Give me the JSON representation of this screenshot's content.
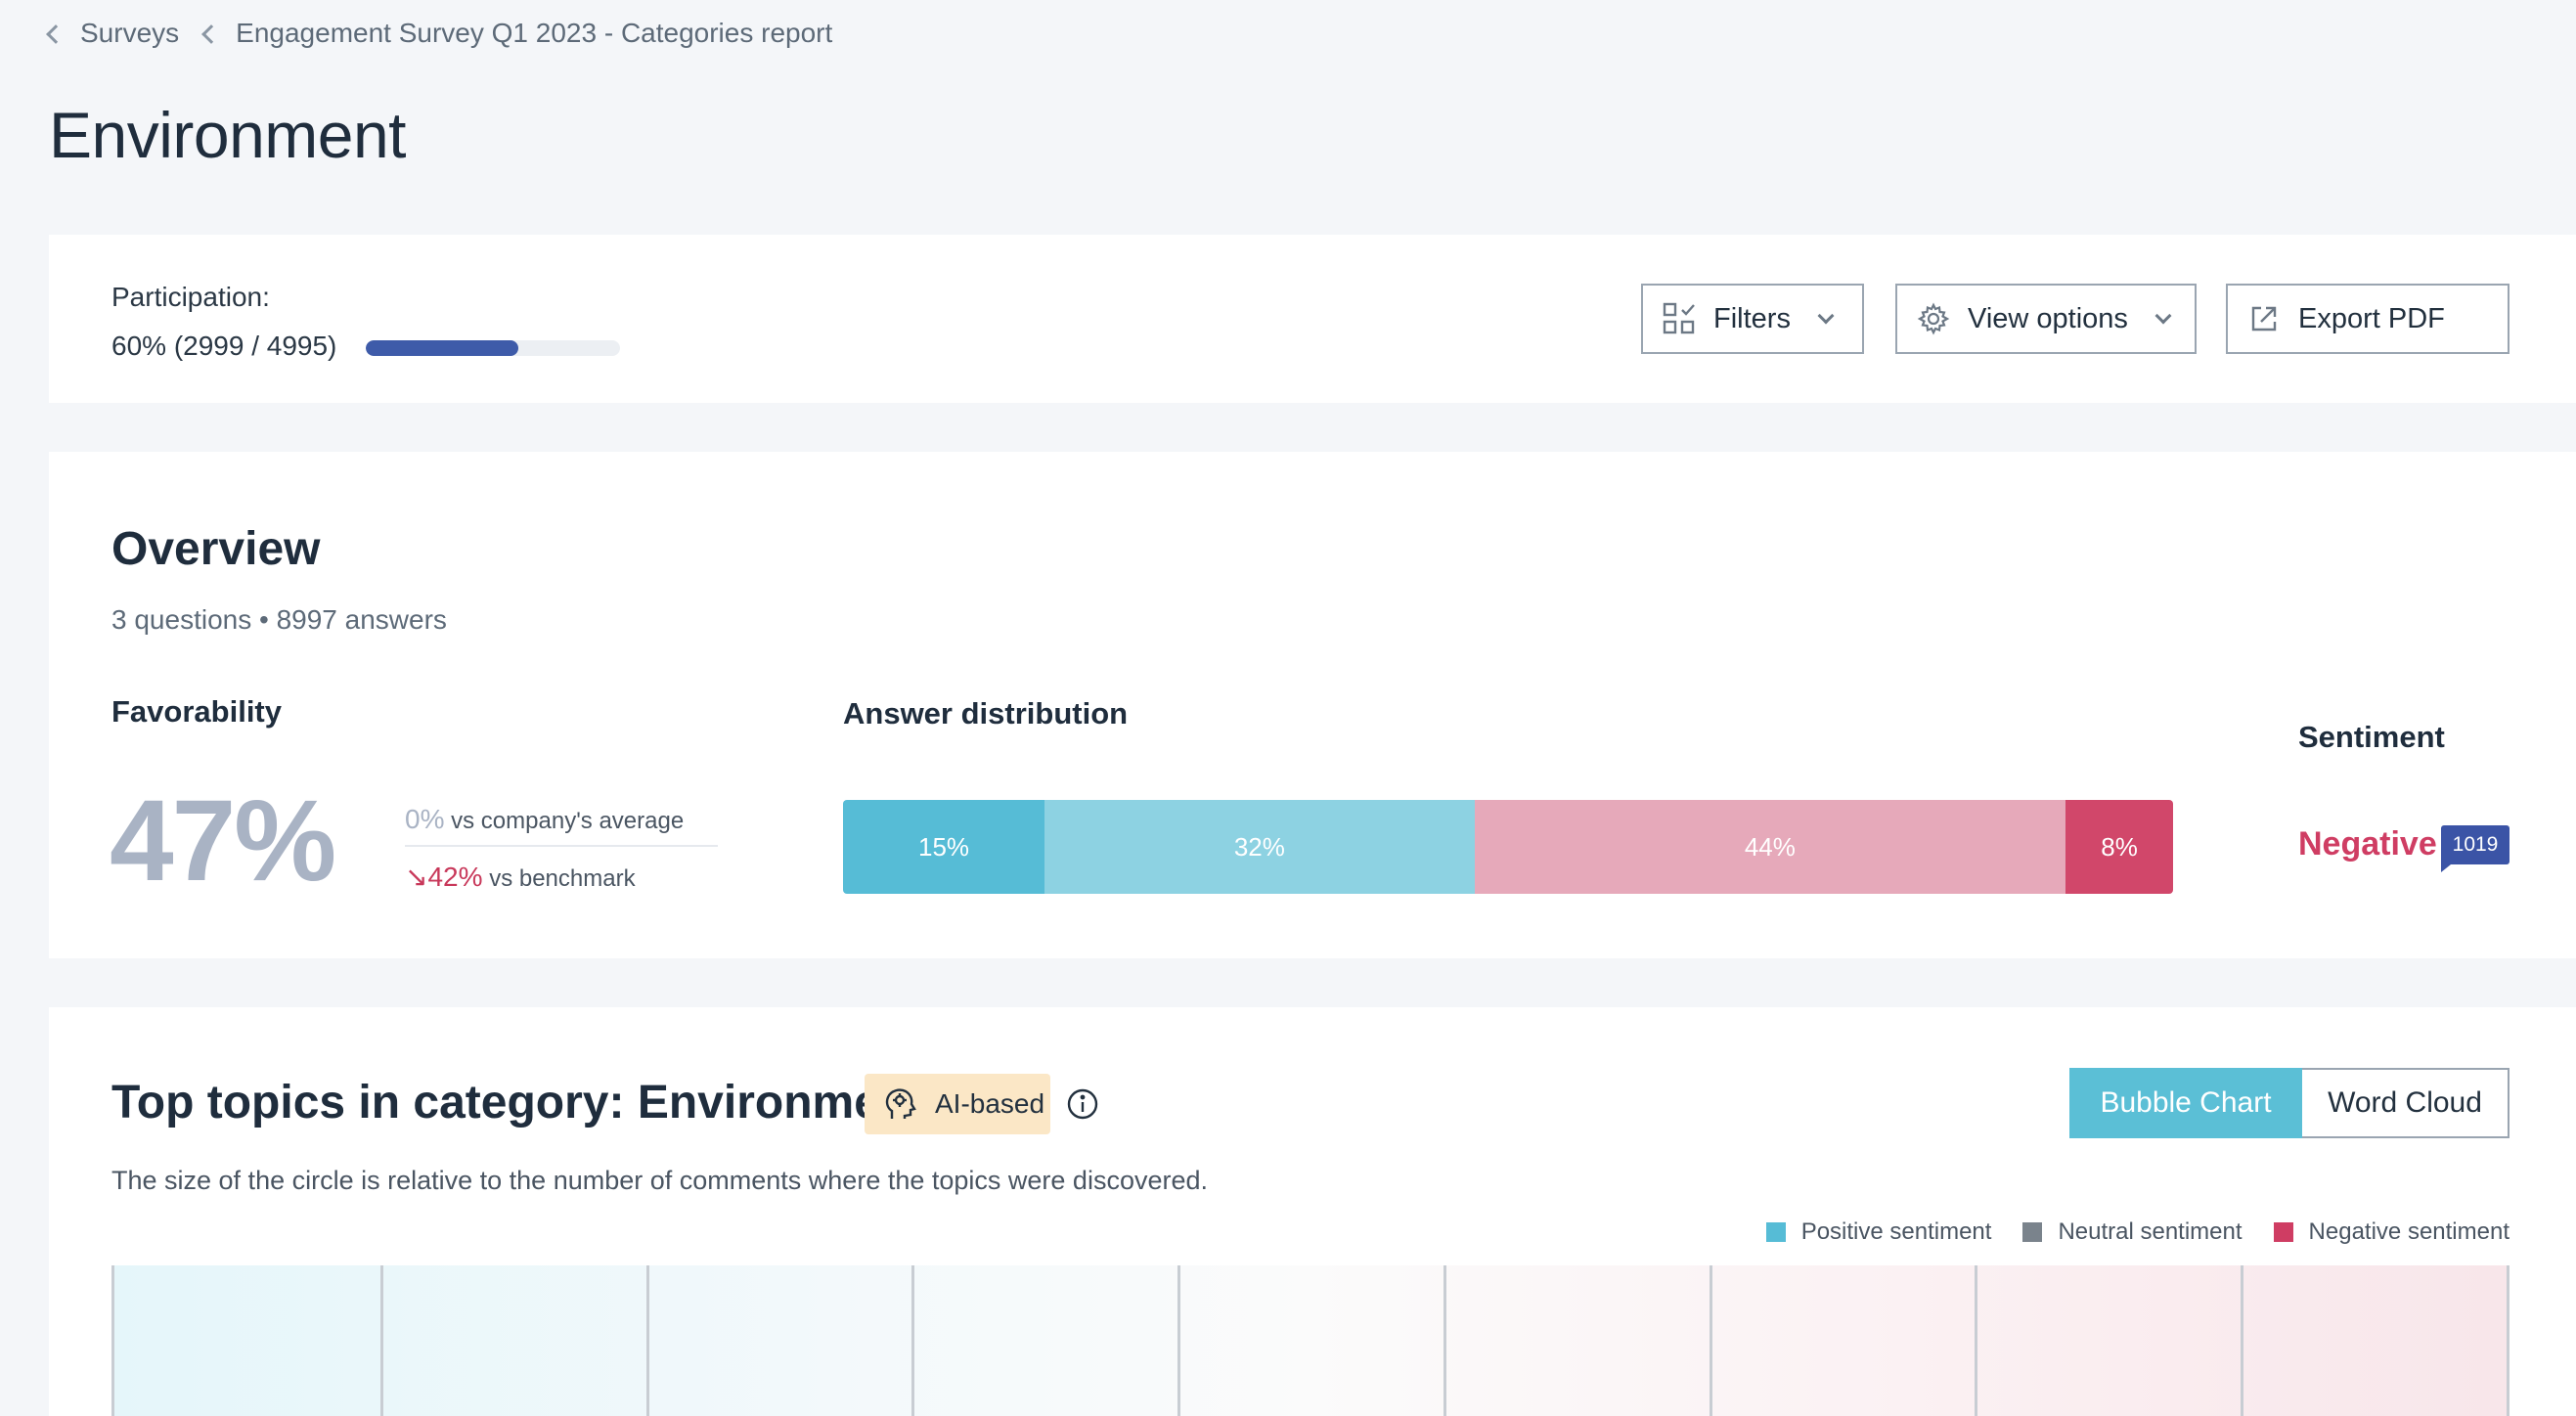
{
  "breadcrumb": {
    "items": [
      "Surveys",
      "Engagement Survey Q1 2023 - Categories report"
    ]
  },
  "page_title": "Environment",
  "participation": {
    "label": "Participation:",
    "value_text": "60% (2999 / 4995)",
    "fraction": 0.6
  },
  "toolbar": {
    "filters_label": "Filters",
    "view_options_label": "View options",
    "export_label": "Export PDF",
    "filters_icon": "filter-grid-icon",
    "view_options_icon": "gear-icon",
    "export_icon": "export-icon"
  },
  "overview": {
    "title": "Overview",
    "subtitle": "3 questions • 8997 answers",
    "favorability": {
      "label": "Favorability",
      "value": "47%",
      "company_avg_value": "0%",
      "company_avg_text": "vs company's average",
      "benchmark_value": "↘42%",
      "benchmark_text": "vs benchmark"
    },
    "distribution": {
      "label": "Answer distribution",
      "segments": [
        {
          "label": "15%",
          "value": 15,
          "color": "#56bcd6"
        },
        {
          "label": "32%",
          "value": 32,
          "color": "#8dd2e2"
        },
        {
          "label": "44%",
          "value": 44,
          "color": "#e6a9ba"
        },
        {
          "label": "8%",
          "value": 8,
          "color": "#d1476a"
        }
      ]
    },
    "sentiment": {
      "label": "Sentiment",
      "value": "Negative",
      "count": "1019",
      "color": "#cf3d63"
    }
  },
  "topics": {
    "title": "Top topics in category: Environment",
    "ai_badge": "AI-based",
    "ai_icon": "ai-brain-icon",
    "info_icon": "info-icon",
    "subtitle": "The size of the circle is relative to the number of comments where the topics were discovered.",
    "view_toggle": {
      "bubble_chart": "Bubble Chart",
      "word_cloud": "Word Cloud",
      "selected": "Bubble Chart"
    },
    "legend": [
      {
        "label": "Positive sentiment",
        "color": "#56bcd6"
      },
      {
        "label": "Neutral sentiment",
        "color": "#7a838c"
      },
      {
        "label": "Negative sentiment",
        "color": "#cf3d63"
      }
    ]
  }
}
